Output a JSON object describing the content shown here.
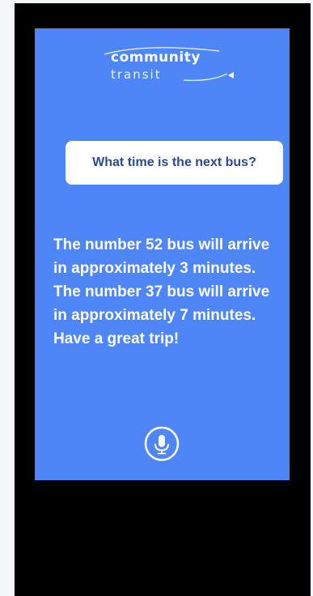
{
  "logo": {
    "word_top": "community",
    "word_bottom": "transit"
  },
  "question": {
    "text": "What time is the next bus?"
  },
  "answer": {
    "text": "The number 52 bus will arrive in approximately 3 minutes. The number 37 bus will arrive in approximately 7 minutes. Have a great trip!"
  },
  "mic": {
    "icon": "microphone-icon"
  },
  "colors": {
    "screen": "#4f86f7",
    "bubble_text": "#2c4b8e",
    "frame": "#000000",
    "page": "#f3f7f8"
  }
}
